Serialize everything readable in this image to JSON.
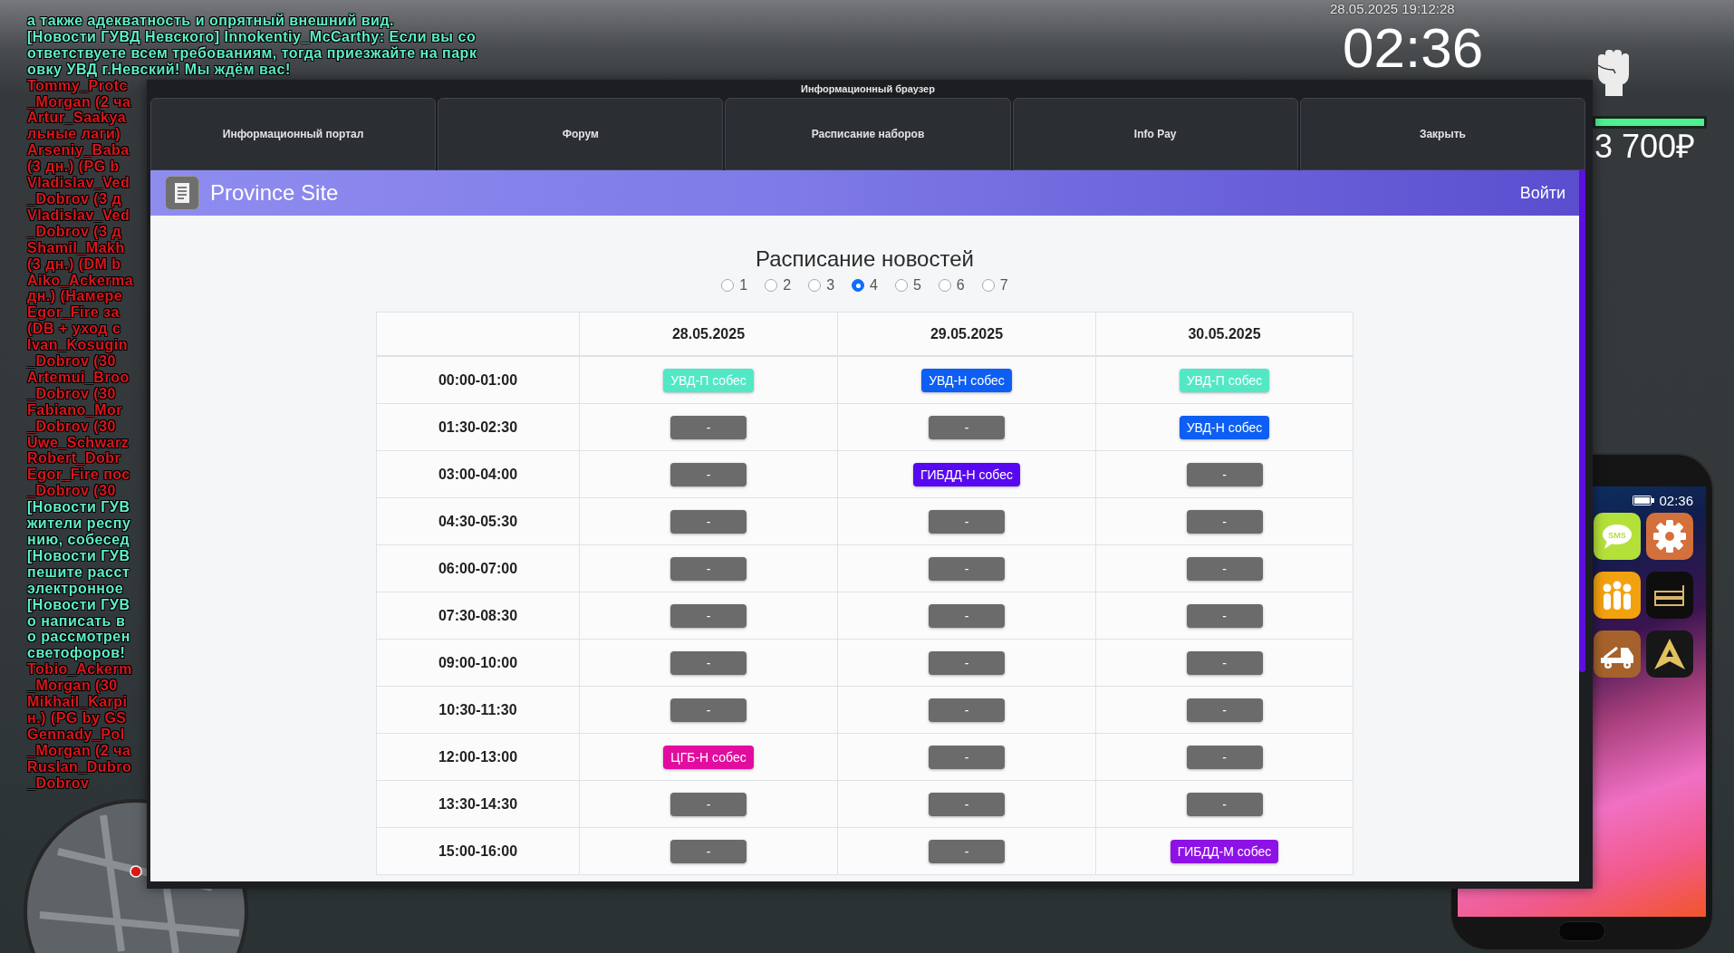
{
  "chat": {
    "lines": [
      {
        "text": "а также адекватность и опрятный внешний вид.",
        "color": "#5eeec6"
      },
      {
        "text": "[Новости ГУВД Невского] Innokentiy_McCarthy: Если вы со",
        "color": "#5eeec6"
      },
      {
        "text": "ответствуете всем требованиям, тогда приезжайте на парк",
        "color": "#5eeec6"
      },
      {
        "text": "овку УВД г.Невский! Мы ждём вас!",
        "color": "#5eeec6"
      },
      {
        "text": "Tommy_Protc",
        "color": "#d8161c"
      },
      {
        "text": "_Morgan (2 ча",
        "color": "#d8161c"
      },
      {
        "text": "Artur_Saakya",
        "color": "#d8161c"
      },
      {
        "text": "льные лаги)",
        "color": "#d8161c"
      },
      {
        "text": "Arseniy_Baba",
        "color": "#d8161c"
      },
      {
        "text": "(3 дн.) (PG b",
        "color": "#d8161c"
      },
      {
        "text": "Vladislav_Ved",
        "color": "#d8161c"
      },
      {
        "text": "_Dobrov (3 д",
        "color": "#d8161c"
      },
      {
        "text": "Vladislav_Ved",
        "color": "#d8161c"
      },
      {
        "text": "_Dobrov (3 д",
        "color": "#d8161c"
      },
      {
        "text": "Shamil_Makh",
        "color": "#d8161c"
      },
      {
        "text": "(3 дн.) (DM b",
        "color": "#d8161c"
      },
      {
        "text": "Aiko_Ackerma",
        "color": "#d8161c"
      },
      {
        "text": "дн.) (Намере",
        "color": "#d8161c"
      },
      {
        "text": "Egor_Fire за",
        "color": "#d8161c"
      },
      {
        "text": "(DB + уход с",
        "color": "#d8161c"
      },
      {
        "text": "Ivan_Kosugin",
        "color": "#d8161c"
      },
      {
        "text": "_Dobrov (30",
        "color": "#d8161c"
      },
      {
        "text": "Artemui_Broo",
        "color": "#d8161c"
      },
      {
        "text": "_Dobrov (30",
        "color": "#d8161c"
      },
      {
        "text": "Fabiano_Mor",
        "color": "#d8161c"
      },
      {
        "text": "_Dobrov (30",
        "color": "#d8161c"
      },
      {
        "text": "Uwe_Schwarz",
        "color": "#d8161c"
      },
      {
        "text": "Robert_Dobr",
        "color": "#d8161c"
      },
      {
        "text": "Egor_Fire пос",
        "color": "#d8161c"
      },
      {
        "text": "_Dobrov (30",
        "color": "#d8161c"
      },
      {
        "text": "[Новости ГУВ",
        "color": "#5eeec6"
      },
      {
        "text": "жители респу",
        "color": "#5eeec6"
      },
      {
        "text": "нию, собесед",
        "color": "#5eeec6"
      },
      {
        "text": "[Новости ГУВ",
        "color": "#5eeec6"
      },
      {
        "text": "пешите расст",
        "color": "#5eeec6"
      },
      {
        "text": "электронное",
        "color": "#5eeec6"
      },
      {
        "text": "[Новости ГУВ",
        "color": "#5eeec6"
      },
      {
        "text": "о написать в",
        "color": "#5eeec6"
      },
      {
        "text": "о рассмотрен",
        "color": "#5eeec6"
      },
      {
        "text": "светофоров!",
        "color": "#5eeec6"
      },
      {
        "text": "Tobio_Ackerm",
        "color": "#d8161c"
      },
      {
        "text": "_Morgan (30",
        "color": "#d8161c"
      },
      {
        "text": "Mikhail_Karpi",
        "color": "#d8161c"
      },
      {
        "text": "н.) (PG by GS",
        "color": "#d8161c"
      },
      {
        "text": "Gennady_Pol",
        "color": "#d8161c"
      },
      {
        "text": "_Morgan (2 ча",
        "color": "#d8161c"
      },
      {
        "text": "Ruslan_Dubro",
        "color": "#d8161c"
      },
      {
        "text": "_Dobrov",
        "color": "#d8161c"
      }
    ]
  },
  "hud": {
    "datetime": "28.05.2025 19:12:28",
    "clock": "02:36",
    "bar": {
      "level": 1
    },
    "money": "3 700₽"
  },
  "browser": {
    "title": "Информационный браузер",
    "tabs": [
      "Информационный портал",
      "Форум",
      "Расписание наборов",
      "Info Pay",
      "Закрыть"
    ],
    "site": {
      "name": "Province Site",
      "login": "Войти"
    },
    "page": {
      "title": "Расписание новостей",
      "days": [
        {
          "label": "1",
          "selected": false
        },
        {
          "label": "2",
          "selected": false
        },
        {
          "label": "3",
          "selected": false
        },
        {
          "label": "4",
          "selected": true
        },
        {
          "label": "5",
          "selected": false
        },
        {
          "label": "6",
          "selected": false
        },
        {
          "label": "7",
          "selected": false
        }
      ],
      "table": {
        "columns": [
          "28.05.2025",
          "29.05.2025",
          "30.05.2025"
        ],
        "rows": [
          {
            "time": "00:00-01:00",
            "slots": [
              {
                "text": "УВД-П собес",
                "color": "#52e8c6"
              },
              {
                "text": "УВД-Н собес",
                "color": "#0d5ef2"
              },
              {
                "text": "УВД-П собес",
                "color": "#52e8c6"
              }
            ]
          },
          {
            "time": "01:30-02:30",
            "slots": [
              {
                "text": "-",
                "color": "#6b6b6b"
              },
              {
                "text": "-",
                "color": "#6b6b6b"
              },
              {
                "text": "УВД-Н собес",
                "color": "#0d5ef2"
              }
            ]
          },
          {
            "time": "03:00-04:00",
            "slots": [
              {
                "text": "-",
                "color": "#6b6b6b"
              },
              {
                "text": "ГИБДД-Н собес",
                "color": "#5808f0"
              },
              {
                "text": "-",
                "color": "#6b6b6b"
              }
            ]
          },
          {
            "time": "04:30-05:30",
            "slots": [
              {
                "text": "-",
                "color": "#6b6b6b"
              },
              {
                "text": "-",
                "color": "#6b6b6b"
              },
              {
                "text": "-",
                "color": "#6b6b6b"
              }
            ]
          },
          {
            "time": "06:00-07:00",
            "slots": [
              {
                "text": "-",
                "color": "#6b6b6b"
              },
              {
                "text": "-",
                "color": "#6b6b6b"
              },
              {
                "text": "-",
                "color": "#6b6b6b"
              }
            ]
          },
          {
            "time": "07:30-08:30",
            "slots": [
              {
                "text": "-",
                "color": "#6b6b6b"
              },
              {
                "text": "-",
                "color": "#6b6b6b"
              },
              {
                "text": "-",
                "color": "#6b6b6b"
              }
            ]
          },
          {
            "time": "09:00-10:00",
            "slots": [
              {
                "text": "-",
                "color": "#6b6b6b"
              },
              {
                "text": "-",
                "color": "#6b6b6b"
              },
              {
                "text": "-",
                "color": "#6b6b6b"
              }
            ]
          },
          {
            "time": "10:30-11:30",
            "slots": [
              {
                "text": "-",
                "color": "#6b6b6b"
              },
              {
                "text": "-",
                "color": "#6b6b6b"
              },
              {
                "text": "-",
                "color": "#6b6b6b"
              }
            ]
          },
          {
            "time": "12:00-13:00",
            "slots": [
              {
                "text": "ЦГБ-Н собес",
                "color": "#e20c9e"
              },
              {
                "text": "-",
                "color": "#6b6b6b"
              },
              {
                "text": "-",
                "color": "#6b6b6b"
              }
            ]
          },
          {
            "time": "13:30-14:30",
            "slots": [
              {
                "text": "-",
                "color": "#6b6b6b"
              },
              {
                "text": "-",
                "color": "#6b6b6b"
              },
              {
                "text": "-",
                "color": "#6b6b6b"
              }
            ]
          },
          {
            "time": "15:00-16:00",
            "slots": [
              {
                "text": "-",
                "color": "#6b6b6b"
              },
              {
                "text": "-",
                "color": "#6b6b6b"
              },
              {
                "text": "ГИБДД-М собес",
                "color": "#8e12e6"
              }
            ]
          }
        ]
      }
    }
  },
  "phone": {
    "time": "02:36",
    "apps": [
      {
        "kind": "sms",
        "label": "SMS"
      },
      {
        "kind": "settings"
      },
      {
        "kind": "people"
      },
      {
        "kind": "bed"
      },
      {
        "kind": "truck"
      },
      {
        "kind": "navigator"
      }
    ]
  }
}
